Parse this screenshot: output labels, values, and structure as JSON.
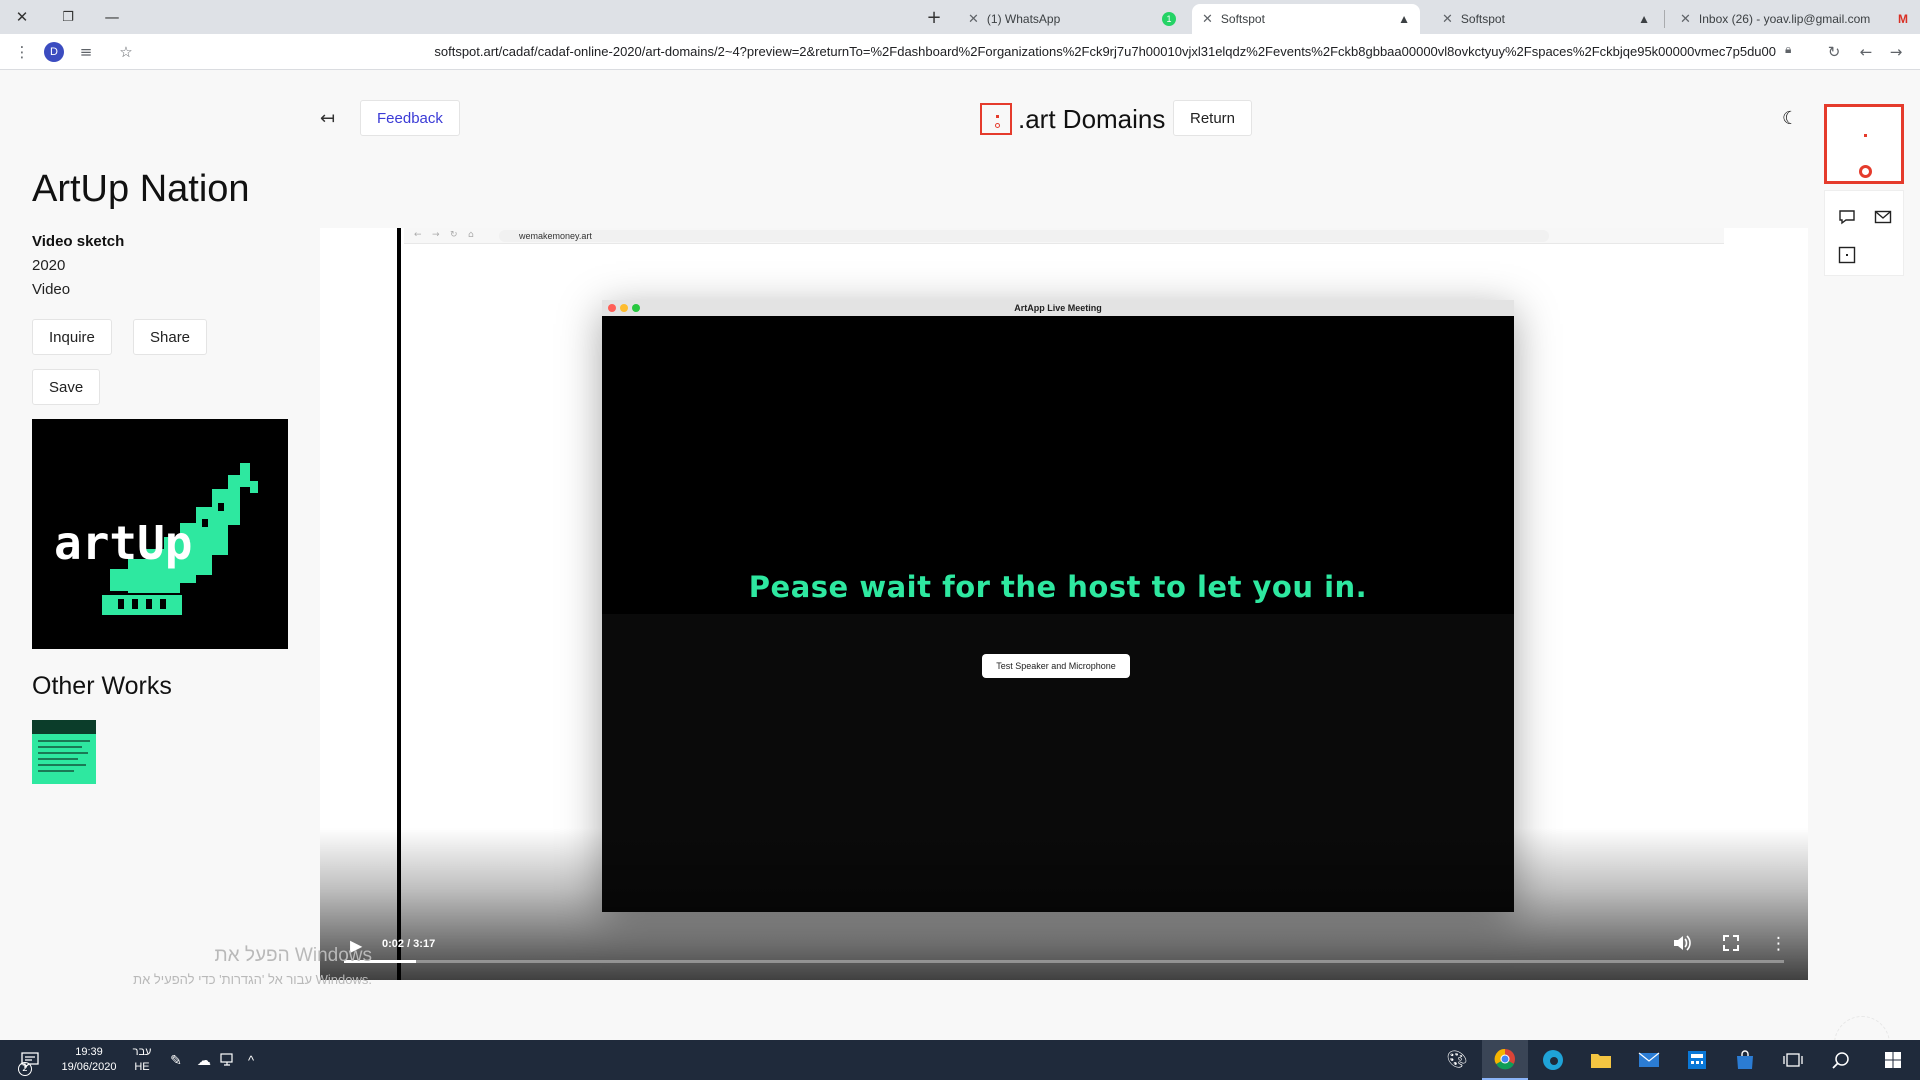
{
  "browser": {
    "tabs": [
      {
        "title": "Inbox (26) - yoav.lip@gmail.com",
        "favicon": "gmail-icon",
        "active": false
      },
      {
        "title": "Softspot",
        "favicon": "softspot-icon",
        "active": false
      },
      {
        "title": "Softspot",
        "favicon": "softspot-icon",
        "active": true
      },
      {
        "title": "(1) WhatsApp",
        "favicon": "whatsapp-icon",
        "badge": "1",
        "active": false
      }
    ],
    "profile_initial": "D",
    "url": "softspot.art/cadaf/cadaf-online-2020/art-domains/2~4?preview=2&returnTo=%2Fdashboard%2Forganizations%2Fck9rj7u7h00010vjxl31elqdz%2Fevents%2Fckb8gbbaa00000vl8ovkctyuy%2Fspaces%2Fckbjqe95k00000vmec7p5du00"
  },
  "header": {
    "feedback_label": "Feedback",
    "site_title": ".art Domains",
    "return_label": "Return"
  },
  "artwork": {
    "title": "ArtUp Nation",
    "subtitle": "Video sketch",
    "year": "2020",
    "medium": "Video",
    "inquire_label": "Inquire",
    "share_label": "Share",
    "save_label": "Save",
    "thumb_logo_text": "artUp"
  },
  "other_works": {
    "heading": "Other Works"
  },
  "video": {
    "inner_url": "wemakemoney.art",
    "meeting_title": "ArtApp Live Meeting",
    "wait_message": "Pease wait for the host to let you in.",
    "test_button": "Test Speaker and Microphone",
    "time": "0:02 / 3:17",
    "progress_fraction": 0.05
  },
  "watermark": {
    "line1": "הפעל את Windows",
    "line2": "עבור אל 'הגדרות' כדי להפעיל את Windows."
  },
  "taskbar": {
    "notification_count": "2",
    "time": "19:39",
    "date": "19/06/2020",
    "lang_top": "עבר",
    "lang_bottom": "HE"
  },
  "colors": {
    "accent": "#e53b2c",
    "wait_text": "#2ee8a0",
    "feedback_link": "#3b3bd6",
    "taskbar": "#1f2a3b"
  }
}
